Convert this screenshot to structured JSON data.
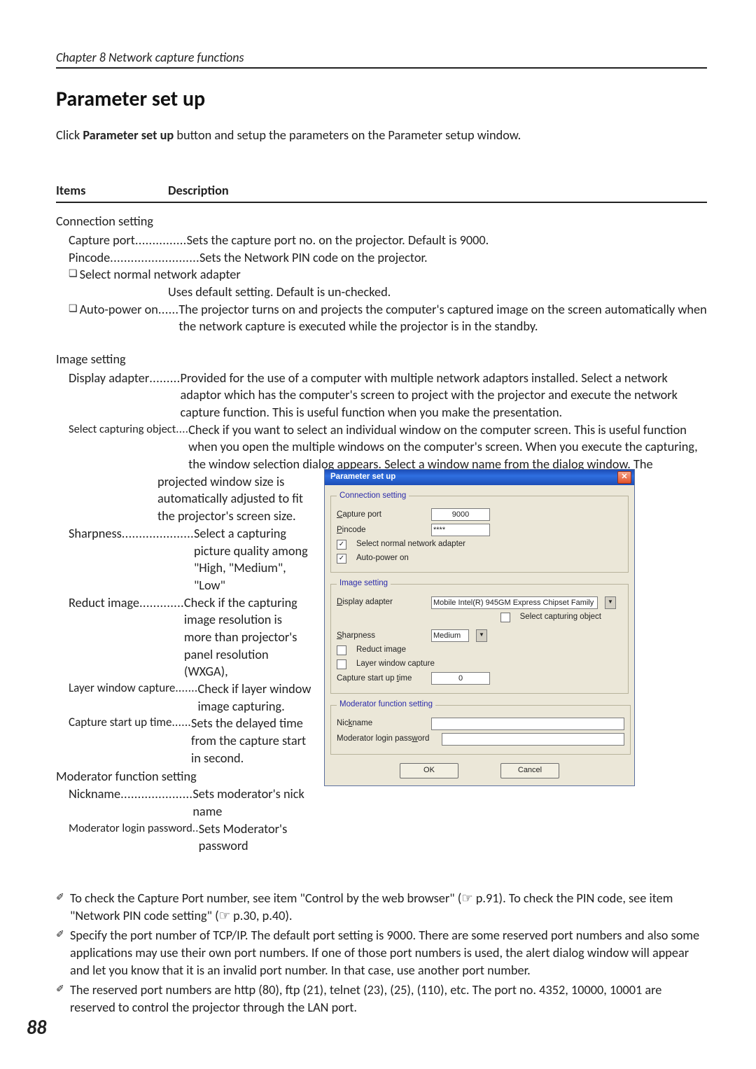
{
  "chapter": "Chapter 8 Network capture functions",
  "title": "Parameter set up",
  "intro": {
    "before": "Click ",
    "bold": "Parameter set up",
    "after": " button and setup the parameters on the Parameter setup window."
  },
  "table_head": {
    "items": "Items",
    "description": "Description"
  },
  "sections": {
    "connection": {
      "label": "Connection setting",
      "capture_port": {
        "term": "Capture port",
        "dots": " ............... ",
        "desc": "Sets the capture port no. on the projector. Default is 9000."
      },
      "pincode": {
        "term": "Pincode",
        "dots": " .......................... ",
        "desc": "Sets the Network PIN code on the projector."
      },
      "select_adapter": {
        "term": "Select normal network adapter",
        "desc": "Uses default setting. Default is un-checked."
      },
      "auto_power": {
        "term": "Auto-power on",
        "dots": "...... ",
        "desc": "The projector turns on and projects the computer's captured image on the screen automatically when the network capture is executed while the projector is in the standby."
      }
    },
    "image": {
      "label": "Image setting",
      "display_adapter": {
        "term": "Display adapter",
        "dots": "......... ",
        "desc": "Provided for the use of a computer with multiple network adaptors installed. Select a network adaptor which has the computer's screen to project with the projector and execute the network capture function. This is useful function when you make the presentation."
      },
      "select_capobj": {
        "term": "Select capturing object",
        "dots": " .... ",
        "desc_a": "Check if you want to select an individual window on the computer screen. This is useful function when you open the multiple windows on the computer's screen. When you execute the capturing, the window selection dialog appears. Select a window name from the dialog window. The",
        "desc_b": "projected window size is automatically adjusted to fit the projector's screen size."
      },
      "sharpness": {
        "term": "Sharpness",
        "dots": "..................... ",
        "desc": "Select a capturing picture quality among \"High, \"Medium\", \"Low\""
      },
      "reduct": {
        "term": "Reduct image",
        "dots": " ............. ",
        "desc": "Check if the capturing image resolution is more than projector's panel resolution (WXGA),"
      },
      "layer": {
        "term": "Layer window capture",
        "dots": " ....... ",
        "desc": "Check if layer window image capturing."
      },
      "startup": {
        "term": "Capture start up time",
        "dots": " ...... ",
        "desc": "Sets the delayed time from the capture start in second."
      }
    },
    "moderator": {
      "label": "Moderator function setting",
      "nickname": {
        "term": "Nickname",
        "dots": "..................... ",
        "desc": "Sets moderator's nick name"
      },
      "password": {
        "term": "Moderator login password",
        "dots": ".. ",
        "desc": "Sets Moderator's password"
      }
    }
  },
  "dialog": {
    "title": "Parameter set up",
    "groups": {
      "connection": {
        "legend": "Connection setting",
        "capture_port": {
          "label_pre": "C",
          "label_rest": "apture port",
          "value": "9000"
        },
        "pincode": {
          "label_pre": "P",
          "label_rest": "incode",
          "value": "****"
        },
        "select_adapter": {
          "checked": "✓",
          "label_a": "Select normal ",
          "label_u": "n",
          "label_b": "etwork adapter"
        },
        "auto_power": {
          "checked": "✓",
          "label_u": "A",
          "label_rest": "uto-power on"
        }
      },
      "image": {
        "legend": "Image setting",
        "display_adapter": {
          "label_u": "D",
          "label_rest": "isplay adapter",
          "value": "Mobile Intel(R) 945GM Express Chipset Family"
        },
        "select_obj": {
          "checked": "",
          "label_a": "Select capturing ",
          "label_u": "o",
          "label_b": "bject"
        },
        "sharpness": {
          "label_u": "S",
          "label_rest": "harpness",
          "value": "Medium"
        },
        "reduct": {
          "checked": "",
          "label_a": "Reduct ",
          "label_u": "i",
          "label_b": "mage"
        },
        "layer": {
          "checked": "",
          "label_u": "L",
          "label_a": "ayer window capture"
        },
        "startup": {
          "label_a": "Capture start up ",
          "label_u": "t",
          "label_b": "ime",
          "value": "0"
        }
      },
      "moderator": {
        "legend": "Moderator function setting",
        "nickname": {
          "label_a": "Nic",
          "label_u": "k",
          "label_b": "name",
          "value": ""
        },
        "password": {
          "label_a": "Moderator login pass",
          "label_u": "w",
          "label_b": "ord",
          "value": ""
        }
      }
    },
    "buttons": {
      "ok": "OK",
      "cancel": "Cancel"
    }
  },
  "notes": {
    "n1": "To check the Capture Port number,  see item \"Control by the web browser\" (☞ p.91). To check the PIN code, see item \"Network PIN code setting\" (☞ p.30, p.40).",
    "n2": "Specify the port number of TCP/IP. The default port setting is 9000. There are some reserved port numbers and also some applications may use their own port numbers. If one of those port numbers is used, the alert dialog window will appear and let you know that it is an invalid port number. In that case, use another port number.",
    "n3": "The reserved port numbers are http (80), ftp (21), telnet (23), (25), (110), etc. The port no. 4352, 10000, 10001 are reserved to control the projector through the LAN port."
  },
  "page_number": "88"
}
